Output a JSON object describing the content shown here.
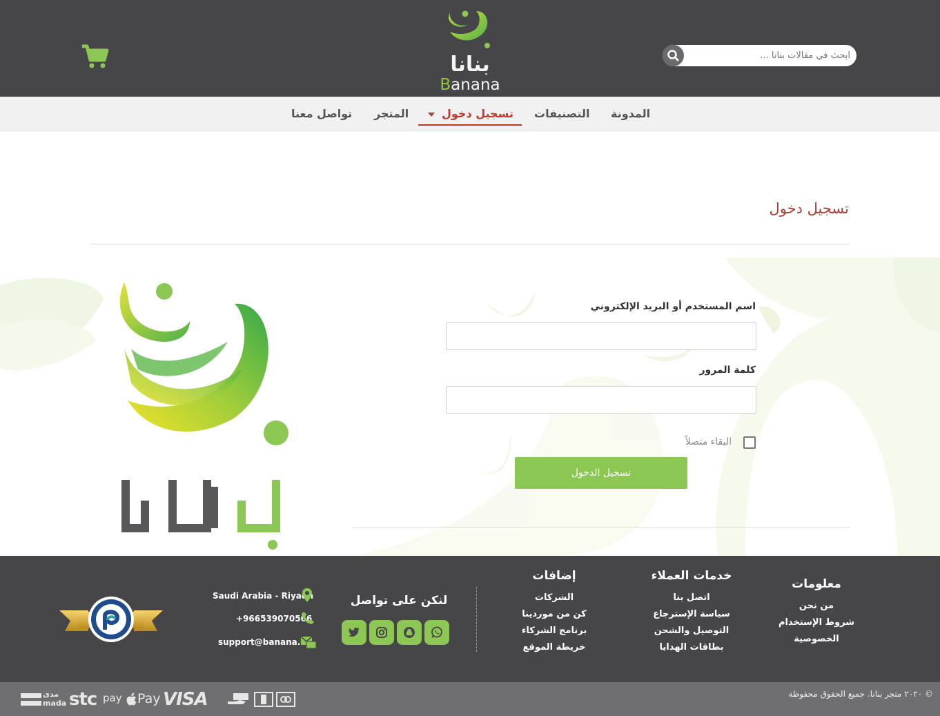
{
  "header": {
    "logo_ar": "بنانا",
    "logo_en_first": "B",
    "logo_en_rest": "anana",
    "search_placeholder": "ابحث في مقالات بنانا ...",
    "cart_icon": "shopping-cart-icon",
    "search_icon": "search-icon"
  },
  "nav": {
    "items": [
      {
        "label": "المدونة"
      },
      {
        "label": "التصنيفات"
      },
      {
        "label": "تسجيل دخول"
      },
      {
        "label": "المتجر"
      },
      {
        "label": "تواصل معنا"
      }
    ]
  },
  "page": {
    "title": "تسجيل دخول"
  },
  "form": {
    "username_label": "اسم المستخدم أو البريد الإلكتروني",
    "username_value": "",
    "password_label": "كلمة المرور",
    "password_value": "",
    "remember_label": "البقاء متصلاً",
    "remember_checked": false,
    "submit_label": "تسجيل الدخول"
  },
  "footer": {
    "info": {
      "heading": "معلومات",
      "links": [
        "من نحن",
        "شروط الإستخدام",
        "الخصوصية"
      ]
    },
    "customer_service": {
      "heading": "خدمات العملاء",
      "links": [
        "اتصل بنا",
        "سياسة الإسترجاع",
        "التوصيل والشحن",
        "بطاقات الهدايا"
      ]
    },
    "extras": {
      "heading": "إضافات",
      "links": [
        "الشركات",
        "كن من موردينا",
        "برنامج الشركاء",
        "خريطة الموقع"
      ]
    },
    "social": {
      "heading": "لنكن على تواصل",
      "icons": [
        "twitter-icon",
        "instagram-icon",
        "snapchat-icon",
        "whatsapp-icon"
      ]
    },
    "contact": {
      "location": "Saudi Arabia - Riyadh",
      "phone": "+966539070566",
      "email": "support@banana.sa"
    },
    "copyright": "© ٢٠٢٠ متجر بنانا. جميع الحقوق محفوظة",
    "payments": {
      "mada_ar": "مدى",
      "mada_en": "mada",
      "stc": "stc",
      "stc_pay": "pay",
      "apple_pay": "Pay",
      "visa": "VISA"
    }
  },
  "colors": {
    "header_bg": "#464649",
    "brand_green": "#8dc753",
    "accent_red": "#c0392b",
    "nav_bg": "#f1f1f2"
  }
}
